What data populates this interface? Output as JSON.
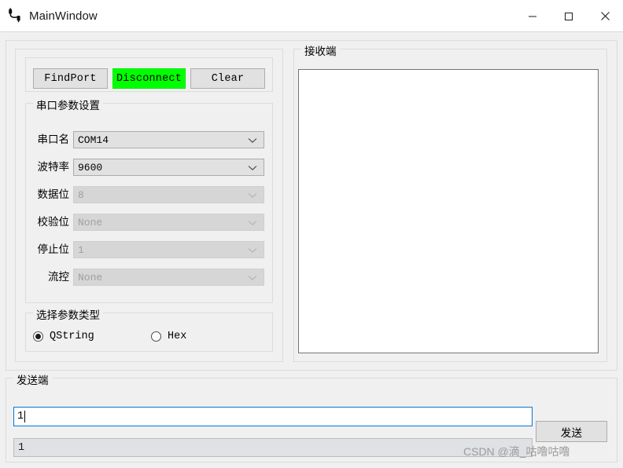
{
  "window": {
    "title": "MainWindow",
    "icon": "serial-cable-icon",
    "controls": {
      "minimize": "—",
      "maximize": "☐",
      "close": "✕"
    }
  },
  "toolbar": {
    "find_port_label": "FindPort",
    "disconnect_label": "Disconnect",
    "clear_label": "Clear",
    "disconnect_bg": "#00FF00"
  },
  "params_group": {
    "title": "串口参数设置",
    "rows": [
      {
        "label": "串口名",
        "value": "COM14",
        "disabled": false
      },
      {
        "label": "波特率",
        "value": "9600",
        "disabled": false
      },
      {
        "label": "数据位",
        "value": "8",
        "disabled": true
      },
      {
        "label": "校验位",
        "value": "None",
        "disabled": true
      },
      {
        "label": "停止位",
        "value": "1",
        "disabled": true
      },
      {
        "label": "流控",
        "value": "None",
        "disabled": true
      }
    ]
  },
  "type_group": {
    "title": "选择参数类型",
    "options": [
      {
        "label": "QString",
        "selected": true
      },
      {
        "label": "Hex",
        "selected": false
      }
    ]
  },
  "receive_group": {
    "title": "接收端",
    "content": ""
  },
  "send_group": {
    "title": "发送端",
    "input_value": "1",
    "input_placeholder": "",
    "echo_value": "1",
    "send_button_label": "发送"
  },
  "watermark": {
    "text": "CSDN @滴_咕噜咕噜"
  },
  "colors": {
    "window_bg": "#F0F0F0",
    "accent_focus": "#0078D7",
    "button_bg": "#E1E1E1",
    "green": "#00FF00"
  }
}
